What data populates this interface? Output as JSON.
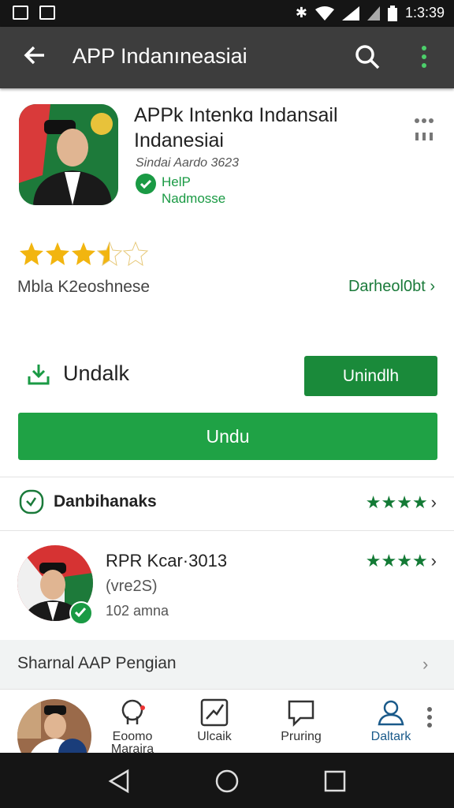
{
  "status_bar": {
    "time": "1:3:39"
  },
  "app_bar": {
    "title": "APP Indanıneasiai"
  },
  "app": {
    "title": "APPk Intenkɑ Indansail Indanesiai",
    "developer": "Sindai Aardo 3623",
    "badge_line1": "HelP",
    "badge_line2": "Nadmosse"
  },
  "rating": {
    "stars": 3.5,
    "text": "Mbla K2eoshnese",
    "link": "Darheol0bt ›"
  },
  "actions": {
    "install_label": "Undalk",
    "secondary_button": "Unindlh",
    "primary_button": "Undu"
  },
  "section": {
    "title": "Danbihanaks",
    "stars": 4
  },
  "review": {
    "name": "RPR Kcar·3013",
    "sub": "(vre2S)",
    "size": "102 amna",
    "stars": 4
  },
  "similar": {
    "title": "Sharnal AAP Pengian"
  },
  "tabs": [
    {
      "label": "Eoomo Maraira",
      "icon": "game-icon"
    },
    {
      "label": "Ulcaik",
      "icon": "apps-icon"
    },
    {
      "label": "Pruring",
      "icon": "chat-icon"
    },
    {
      "label": "Daltark",
      "icon": "user-icon"
    }
  ],
  "colors": {
    "accent": "#1fa245",
    "appbar": "#3d3d3d"
  }
}
